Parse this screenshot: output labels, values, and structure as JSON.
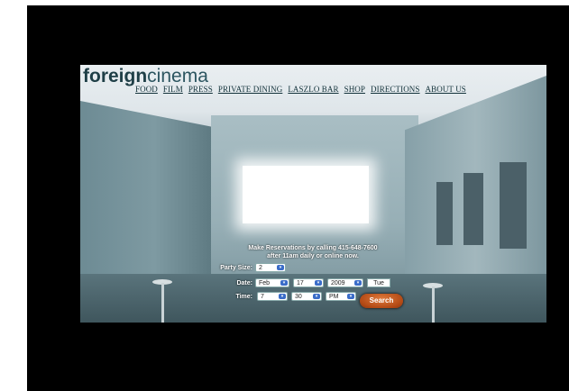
{
  "brand": {
    "logo_bold": "foreign",
    "logo_light": "cinema"
  },
  "nav": {
    "items": [
      "FOOD",
      "FILM",
      "PRESS",
      "PRIVATE DINING",
      "LASZLO BAR",
      "SHOP",
      "DIRECTIONS",
      "ABOUT US"
    ]
  },
  "reservation": {
    "message_line1": "Make Reservations by calling 415-648-7600",
    "message_line2": "after 11am daily or online now.",
    "party_size_label": "Party Size:",
    "party_size": "2",
    "date_label": "Date:",
    "month": "Feb",
    "day": "17",
    "year": "2009",
    "weekday": "Tue",
    "time_label": "Time:",
    "hour": "7",
    "minute": "30",
    "ampm": "PM",
    "search_label": "Search"
  },
  "colors": {
    "accent": "#b34a15",
    "text_dark": "#1f3f47",
    "background": "#000000"
  }
}
